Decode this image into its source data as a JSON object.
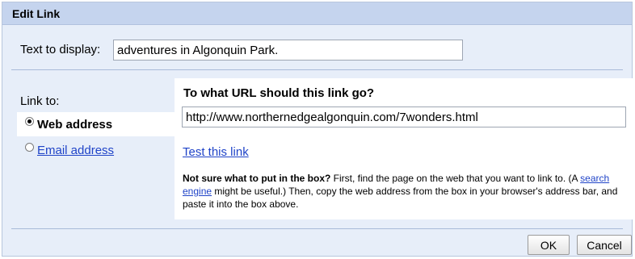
{
  "dialog": {
    "title": "Edit Link"
  },
  "display": {
    "label": "Text to display:",
    "value": "adventures in Algonquin Park."
  },
  "link_to": {
    "label": "Link to:",
    "options": [
      {
        "label": "Web address",
        "selected": true
      },
      {
        "label": "Email address",
        "selected": false
      }
    ]
  },
  "url_panel": {
    "title": "To what URL should this link go?",
    "url_value": "http://www.northernedgealgonquin.com/7wonders.html",
    "test_link": "Test this link",
    "help": {
      "bold_lead": "Not sure what to put in the box?",
      "text_1": " First, find the page on the web that you want to link to. (A ",
      "search_link": "search engine",
      "text_2": " might be useful.) Then, copy the web address from the box in your browser's address bar, and paste it into the box above."
    }
  },
  "buttons": {
    "ok": "OK",
    "cancel": "Cancel"
  },
  "colors": {
    "dialog_bg": "#e7eef9",
    "titlebar_bg": "#c5d4ee",
    "link_color": "#2044c8"
  }
}
